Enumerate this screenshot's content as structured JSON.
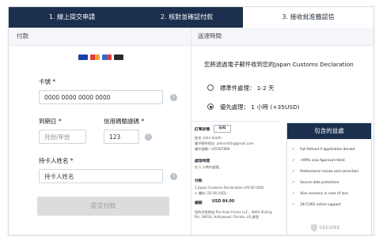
{
  "stepper": {
    "step1": "1. 線上提交申請",
    "step2": "2. 核對並確認付款",
    "step3": "3. 接收批准籤認信"
  },
  "payment": {
    "section_title": "付款",
    "card_brands": [
      "visa",
      "mastercard",
      "maestro",
      "diners"
    ],
    "card_number_label": "卡號 *",
    "card_number_value": "0000 0000 0000 0000",
    "expiry_label": "到期日 *",
    "expiry_placeholder": "月份/年份",
    "cvv_label": "信用碼驗證碼 *",
    "cvv_value": "123",
    "holder_label": "持卡人姓名 *",
    "holder_placeholder": "持卡人姓名",
    "submit_label": "提交付款"
  },
  "delivery": {
    "section_title": "送達時間",
    "description": "您將透過電子郵件收到您的Japan Customs Declaration",
    "options": [
      {
        "label": "標準件處理： 1-2 天",
        "selected": false
      },
      {
        "label": "優先處理： 1 小時 (+35USD)",
        "selected": true
      }
    ]
  },
  "order": {
    "title": "訂單詳情",
    "edit_label": "編輯",
    "name_line": "姓名: John Smith",
    "email_line": "電子郵件地址: johnsmith@gmail.com",
    "phone_line": "國外號碼: +65587899",
    "processing_title": "處理時間",
    "processing_value": "在 1 小時內處理。",
    "payment_title": "付款",
    "payment_line1": "1 Japan Customs Declaration (49.00 USD)",
    "payment_line2": "+ 優先 (35.00 USD)",
    "total_label": "總額",
    "total_value": "USD 84.00",
    "footer": "您的付款將由 Pro Axial Forms LLC., 4664 Shiling Rd, 39024, Hollywood, Florida, US 處理"
  },
  "benefits": {
    "title": "包含的益處",
    "items": [
      "Full Refund if application denied",
      "+99% visa Approval rated",
      "Professional review and correction",
      "Secure data protection",
      "Visa recovery in case of loss",
      "24/7/365 online support"
    ],
    "badge": "SECURE"
  },
  "colors": {
    "navy": "#1b2f4e",
    "check_green": "#2e8b3a",
    "disabled_button": "#dcdcdc"
  }
}
